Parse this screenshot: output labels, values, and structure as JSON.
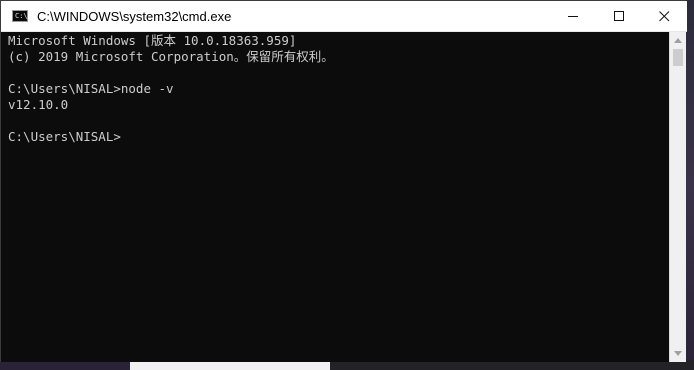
{
  "window": {
    "title": "C:\\WINDOWS\\system32\\cmd.exe",
    "icon": "cmd-icon",
    "icon_glyph": "C:\\"
  },
  "controls": {
    "minimize_icon": "minimize-icon",
    "maximize_icon": "maximize-icon",
    "close_icon": "close-icon"
  },
  "console": {
    "background": "#0c0c0c",
    "foreground": "#cccccc",
    "lines": [
      "Microsoft Windows [版本 10.0.18363.959]",
      "(c) 2019 Microsoft Corporation。保留所有权利。",
      "",
      "C:\\Users\\NISAL>node -v",
      "v12.10.0",
      "",
      "C:\\Users\\NISAL>"
    ]
  }
}
